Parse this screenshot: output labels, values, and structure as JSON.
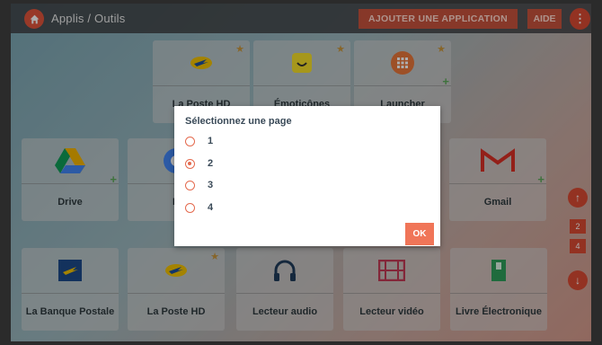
{
  "topbar": {
    "title": "Applis / Outils",
    "add_app_label": "AJOUTER UNE APPLICATION",
    "help_label": "AIDE",
    "more_label": "⋮"
  },
  "tiles_row1": [
    {
      "label": "La Poste HD",
      "icon": "la-poste-bird-icon"
    },
    {
      "label": "Émoticônes",
      "icon": "smiley-icon"
    },
    {
      "label": "Launcher",
      "icon": "grid-apps-icon"
    }
  ],
  "tiles_row2": [
    {
      "label": "Drive",
      "icon": "google-drive-icon"
    },
    {
      "label": "D",
      "icon": "chrome-icon"
    },
    {
      "label": "Gmail",
      "icon": "gmail-icon"
    }
  ],
  "tiles_row3": [
    {
      "label": "La Banque Postale",
      "icon": "la-banque-postale-icon"
    },
    {
      "label": "La Poste HD",
      "icon": "la-poste-bird-icon"
    },
    {
      "label": "Lecteur audio",
      "icon": "headphones-icon"
    },
    {
      "label": "Lecteur vidéo",
      "icon": "film-icon"
    },
    {
      "label": "Livre Électronique",
      "icon": "ebook-icon"
    }
  ],
  "side_nav": {
    "pages": [
      "2",
      "4"
    ]
  },
  "dialog": {
    "title": "Sélectionnez une page",
    "options": [
      "1",
      "2",
      "3",
      "4"
    ],
    "selected": "2",
    "ok_label": "OK"
  },
  "colors": {
    "accent": "#d94b33",
    "ok_button": "#f07558",
    "radio": "#e46a4e"
  }
}
